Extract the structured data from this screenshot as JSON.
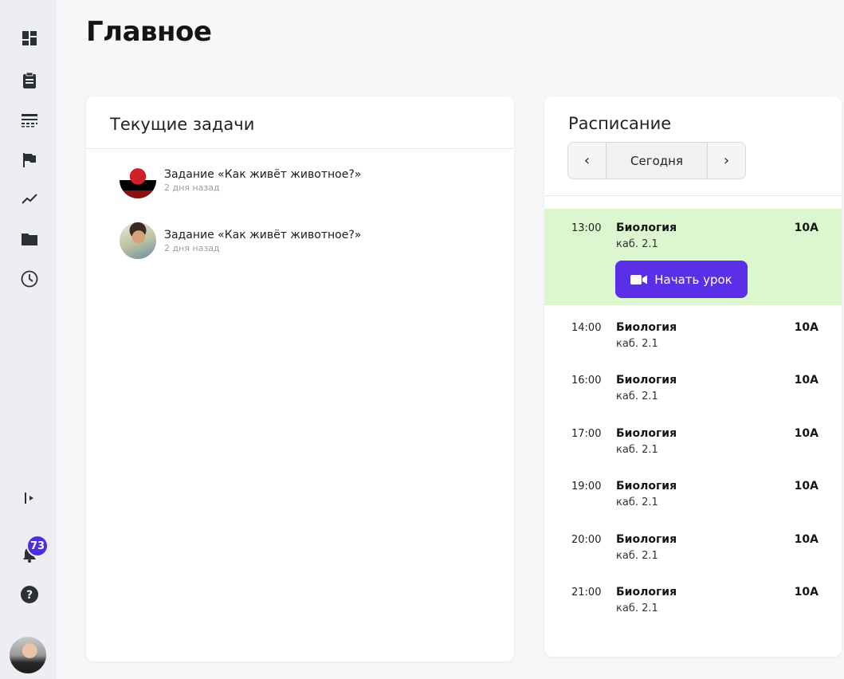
{
  "page": {
    "title": "Главное"
  },
  "sidebar": {
    "items": [
      {
        "name": "dashboard-icon"
      },
      {
        "name": "clipboard-icon"
      },
      {
        "name": "schedule-table-icon"
      },
      {
        "name": "flag-icon"
      },
      {
        "name": "trend-icon"
      },
      {
        "name": "folder-icon"
      },
      {
        "name": "clock-icon"
      }
    ],
    "bottom": {
      "expand": "expand-sidebar-icon",
      "notifications_count": "73",
      "help": "help-icon"
    }
  },
  "tasks": {
    "title": "Текущие задачи",
    "items": [
      {
        "name": "Задание «Как живёт животное?»",
        "time": "2 дня назад"
      },
      {
        "name": "Задание «Как живёт животное?»",
        "time": "2 дня назад"
      }
    ]
  },
  "schedule": {
    "title": "Расписание",
    "prev": "‹",
    "day_label": "Сегодня",
    "next": "›",
    "start_button": "Начать урок",
    "lessons": [
      {
        "time": "13:00",
        "subject": "Биология",
        "room": "каб. 2.1",
        "class": "10А",
        "current": true
      },
      {
        "time": "14:00",
        "subject": "Биология",
        "room": "каб. 2.1",
        "class": "10А"
      },
      {
        "time": "16:00",
        "subject": "Биология",
        "room": "каб. 2.1",
        "class": "10А"
      },
      {
        "time": "17:00",
        "subject": "Биология",
        "room": "каб. 2.1",
        "class": "10А"
      },
      {
        "time": "19:00",
        "subject": "Биология",
        "room": "каб. 2.1",
        "class": "10А"
      },
      {
        "time": "20:00",
        "subject": "Биология",
        "room": "каб. 2.1",
        "class": "10А"
      },
      {
        "time": "21:00",
        "subject": "Биология",
        "room": "каб. 2.1",
        "class": "10А"
      }
    ]
  },
  "colors": {
    "accent": "#5b2ee8",
    "current_lesson_bg": "#dcf7d0",
    "sidebar_bg": "#eceef1"
  }
}
